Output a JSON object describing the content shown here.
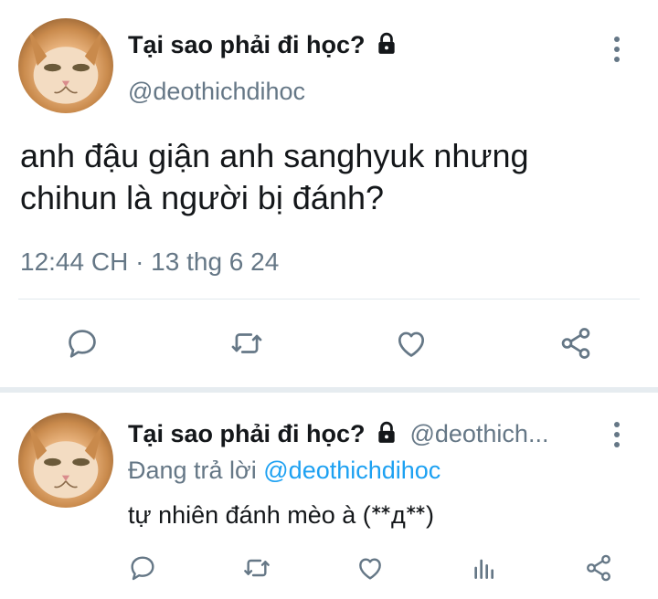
{
  "main_tweet": {
    "author_name": "Tại sao phải đi học?",
    "handle": "@deothichdihoc",
    "text_line1": "anh đậu giận anh sanghyuk nhưng",
    "text_line2": "chihun là người bị đánh?",
    "timestamp": "12:44 CH · 13 thg 6 24",
    "actions": [
      "reply-icon",
      "retweet-icon",
      "like-icon",
      "share-icon"
    ]
  },
  "reply_tweet": {
    "author_name": "Tại sao phải đi học?",
    "handle": "@deothich...",
    "replying_prefix": "Đang trả lời ",
    "replying_to": "@deothichdihoc",
    "text": "tự nhiên đánh mèo à (ᕯдᕯ)",
    "actions": [
      "reply-icon",
      "retweet-icon",
      "like-icon",
      "analytics-icon",
      "share-icon"
    ]
  },
  "colors": {
    "text": "#14171a",
    "muted": "#657786",
    "link": "#1da1f2",
    "divider": "#e1e8ed"
  }
}
